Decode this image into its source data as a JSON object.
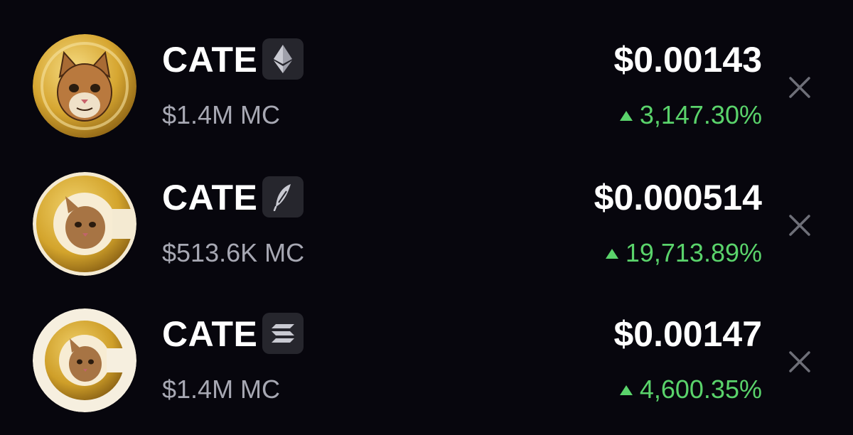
{
  "tokens": [
    {
      "name": "CATE",
      "chain_icon": "ethereum-icon",
      "market_cap": "$1.4M MC",
      "price": "$0.00143",
      "change": "3,147.30%",
      "change_direction": "up"
    },
    {
      "name": "CATE",
      "chain_icon": "feather-chain-icon",
      "market_cap": "$513.6K MC",
      "price": "$0.000514",
      "change": "19,713.89%",
      "change_direction": "up"
    },
    {
      "name": "CATE",
      "chain_icon": "solana-icon",
      "market_cap": "$1.4M MC",
      "price": "$0.00147",
      "change": "4,600.35%",
      "change_direction": "up"
    }
  ],
  "colors": {
    "background": "#07060d",
    "positive": "#5ad36b",
    "muted_text": "#a7a8b3",
    "chain_badge": "#26262d",
    "close_icon": "#6e6f78",
    "gold": "#d4a62a"
  }
}
